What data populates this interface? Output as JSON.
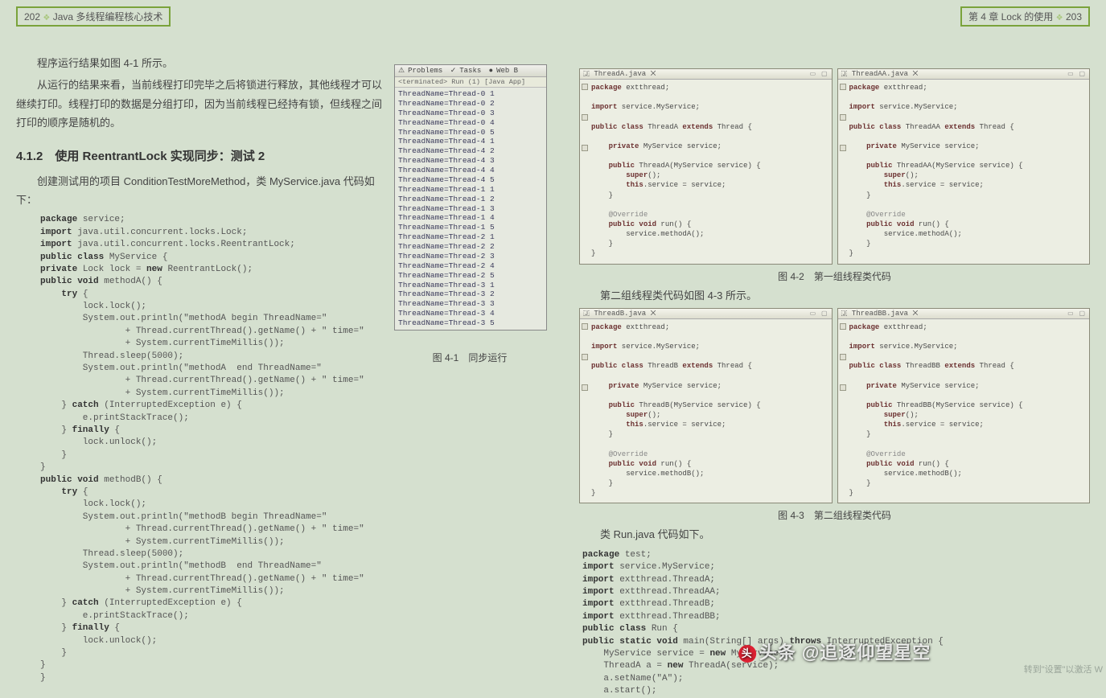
{
  "header": {
    "left_page_num": "202",
    "left_title": "Java 多线程编程核心技术",
    "right_chapter": "第 4 章   Lock 的使用",
    "right_page_num": "203"
  },
  "left": {
    "p1": "程序运行结果如图 4-1 所示。",
    "p2": "从运行的结果来看，当前线程打印完毕之后将锁进行释放，其他线程才可以继续打印。线程打印的数据是分组打印，因为当前线程已经持有锁，但线程之间打印的顺序是随机的。",
    "section": "4.1.2　使用 ReentrantLock 实现同步：测试 2",
    "p3": "创建测试用的项目 ConditionTestMoreMethod，类 MyService.java 代码如下：",
    "fig1_caption": "图 4-1　同步运行",
    "console_tabs": {
      "a": "Problems",
      "b": "Tasks",
      "c": "Web B"
    },
    "console_sub": "<terminated> Run (1) [Java App]",
    "console_lines": [
      "ThreadName=Thread-0 1",
      "ThreadName=Thread-0 2",
      "ThreadName=Thread-0 3",
      "ThreadName=Thread-0 4",
      "ThreadName=Thread-0 5",
      "ThreadName=Thread-4 1",
      "ThreadName=Thread-4 2",
      "ThreadName=Thread-4 3",
      "ThreadName=Thread-4 4",
      "ThreadName=Thread-4 5",
      "ThreadName=Thread-1 1",
      "ThreadName=Thread-1 2",
      "ThreadName=Thread-1 3",
      "ThreadName=Thread-1 4",
      "ThreadName=Thread-1 5",
      "ThreadName=Thread-2 1",
      "ThreadName=Thread-2 2",
      "ThreadName=Thread-2 3",
      "ThreadName=Thread-2 4",
      "ThreadName=Thread-2 5",
      "ThreadName=Thread-3 1",
      "ThreadName=Thread-3 2",
      "ThreadName=Thread-3 3",
      "ThreadName=Thread-3 4",
      "ThreadName=Thread-3 5"
    ]
  },
  "right": {
    "fig2_caption": "图 4-2　第一组线程类代码",
    "p1": "第二组线程类代码如图 4-3 所示。",
    "fig3_caption": "图 4-3　第二组线程类代码",
    "p2": "类 Run.java 代码如下。",
    "ide": {
      "threadA_tab": "ThreadA.java ✕",
      "threadAA_tab": "ThreadAA.java ✕",
      "threadB_tab": "ThreadB.java ✕",
      "threadBB_tab": "ThreadBB.java ✕"
    }
  },
  "watermark": "头条 @追逐仰望星空",
  "activate_hint": "转到\"设置\"以激活 W"
}
